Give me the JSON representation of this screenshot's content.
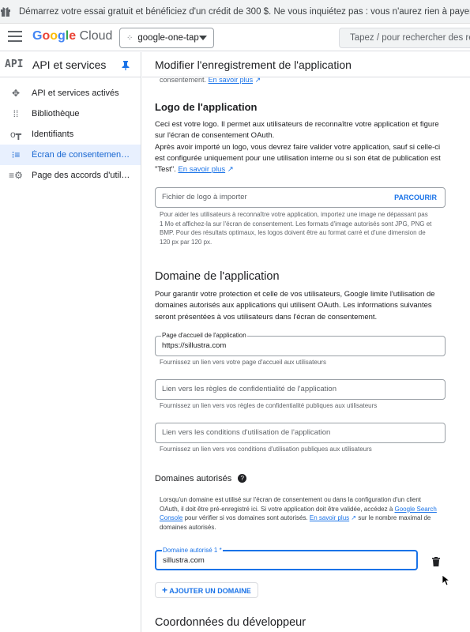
{
  "banner": {
    "icon": "gift-icon",
    "text": "Démarrez votre essai gratuit et bénéficiez d'un crédit de 300 $. Ne vous inquiétez pas : vous n'aurez rien à payer si vous utilise"
  },
  "topbar": {
    "logo_google": "Google",
    "logo_cloud": "Cloud",
    "project": "google-one-tap",
    "search_placeholder": "Tapez / pour rechercher des resso"
  },
  "sidebar": {
    "badge": "API",
    "title": "API et services",
    "items": [
      {
        "label": "API et services activés",
        "icon": "api-icon",
        "active": false
      },
      {
        "label": "Bibliothèque",
        "icon": "library-icon",
        "active": false
      },
      {
        "label": "Identifiants",
        "icon": "key-icon",
        "active": false
      },
      {
        "label": "Écran de consentement O…",
        "icon": "consent-icon",
        "active": true
      },
      {
        "label": "Page des accords d'utilis…",
        "icon": "settings-list-icon",
        "active": false
      }
    ]
  },
  "page": {
    "title": "Modifier l'enregistrement de l'application",
    "cut_text": "consentement.",
    "cut_link": "En savoir plus"
  },
  "logo_section": {
    "heading": "Logo de l'application",
    "para1": "Ceci est votre logo. Il permet aux utilisateurs de reconnaître votre application et figure sur l'écran de consentement OAuth.",
    "para2": "Après avoir importé un logo, vous devrez faire valider votre application, sauf si celle-ci est configurée uniquement pour une utilisation interne ou si son état de publication est \"Test\".",
    "link": "En savoir plus",
    "file_placeholder": "Fichier de logo à importer",
    "browse_label": "PARCOURIR",
    "hint": "Pour aider les utilisateurs à reconnaître votre application, importez une image ne dépassant pas 1 Mo et affichez-la sur l'écran de consentement. Les formats d'image autorisés sont JPG, PNG et BMP. Pour des résultats optimaux, les logos doivent être au format carré et d'une dimension de 120 px par 120 px."
  },
  "domain_section": {
    "heading": "Domaine de l'application",
    "para": "Pour garantir votre protection et celle de vos utilisateurs, Google limite l'utilisation de domaines autorisés aux applications qui utilisent OAuth. Les informations suivantes seront présentées à vos utilisateurs dans l'écran de consentement.",
    "homepage_label": "Page d'accueil de l'application",
    "homepage_value": "https://sillustra.com",
    "homepage_hint": "Fournissez un lien vers votre page d'accueil aux utilisateurs",
    "privacy_placeholder": "Lien vers les règles de confidentialité de l'application",
    "privacy_hint": "Fournissez un lien vers vos règles de confidentialité publiques aux utilisateurs",
    "terms_placeholder": "Lien vers les conditions d'utilisation de l'application",
    "terms_hint": "Fournissez un lien vers vos conditions d'utilisation publiques aux utilisateurs"
  },
  "authorized": {
    "heading": "Domaines autorisés",
    "help": "?",
    "para_a": "Lorsqu'un domaine est utilisé sur l'écran de consentement ou dans la configuration d'un client OAuth, il doit être pré-enregistré ici. Si votre application doit être validée, accédez à",
    "search_console": "Google Search Console",
    "para_b": "pour vérifier si vos domaines sont autorisés.",
    "link": "En savoir plus",
    "para_c": "sur le nombre maximal de domaines autorisés.",
    "domain_label": "Domaine autorisé 1 *",
    "domain_value": "sillustra.com",
    "add_label": "AJOUTER UN DOMAINE"
  },
  "developer": {
    "heading": "Coordonnées du développeur"
  },
  "colors": {
    "accent": "#1a73e8",
    "active_bg": "#e8f0fe",
    "border": "#dadce0"
  }
}
